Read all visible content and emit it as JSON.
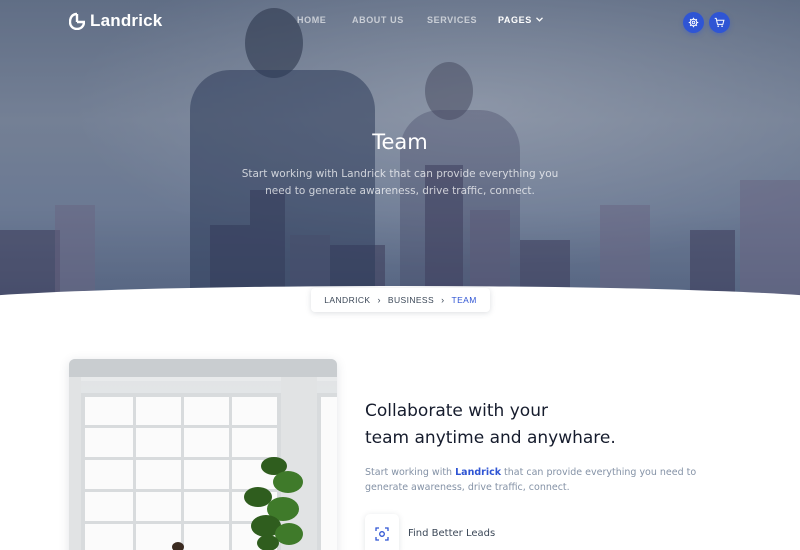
{
  "brand": {
    "name": "Landrick"
  },
  "nav": {
    "items": [
      {
        "label": "HOME"
      },
      {
        "label": "ABOUT US"
      },
      {
        "label": "SERVICES"
      },
      {
        "label": "PAGES"
      }
    ],
    "settings_icon": "gear-icon",
    "cart_icon": "cart-icon"
  },
  "hero": {
    "title": "Team",
    "subtitle": "Start working with Landrick that can provide everything you need to generate awareness, drive traffic, connect."
  },
  "breadcrumb": {
    "items": [
      {
        "label": "LANDRICK"
      },
      {
        "label": "BUSINESS"
      },
      {
        "label": "TEAM"
      }
    ]
  },
  "section": {
    "heading_line1": "Collaborate with your",
    "heading_line2": "team anytime and anywhare.",
    "desc_before": "Start working with ",
    "desc_brand": "Landrick",
    "desc_after": " that can provide everything you need to generate awareness, drive traffic, connect.",
    "feature": {
      "label": "Find Better Leads",
      "icon": "focus-icon"
    }
  },
  "colors": {
    "primary": "#2f55d4",
    "heading": "#161c2d",
    "muted": "#8492a6"
  }
}
